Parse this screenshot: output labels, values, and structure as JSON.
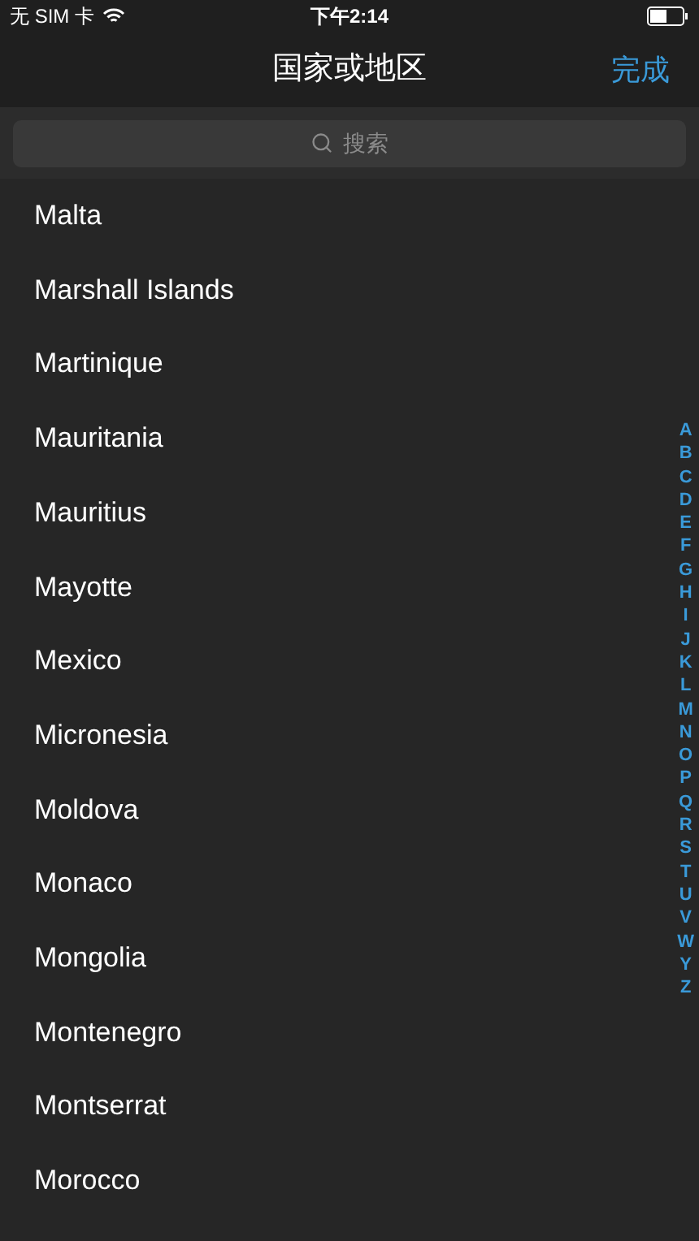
{
  "status_bar": {
    "carrier": "无 SIM 卡",
    "time": "下午2:14"
  },
  "nav_bar": {
    "title": "国家或地区",
    "done_button": "完成"
  },
  "search": {
    "placeholder": "搜索"
  },
  "countries": [
    "Malta",
    "Marshall Islands",
    "Martinique",
    "Mauritania",
    "Mauritius",
    "Mayotte",
    "Mexico",
    "Micronesia",
    "Moldova",
    "Monaco",
    "Mongolia",
    "Montenegro",
    "Montserrat",
    "Morocco"
  ],
  "index": [
    "A",
    "B",
    "C",
    "D",
    "E",
    "F",
    "G",
    "H",
    "I",
    "J",
    "K",
    "L",
    "M",
    "N",
    "O",
    "P",
    "Q",
    "R",
    "S",
    "T",
    "U",
    "V",
    "W",
    "Y",
    "Z"
  ]
}
